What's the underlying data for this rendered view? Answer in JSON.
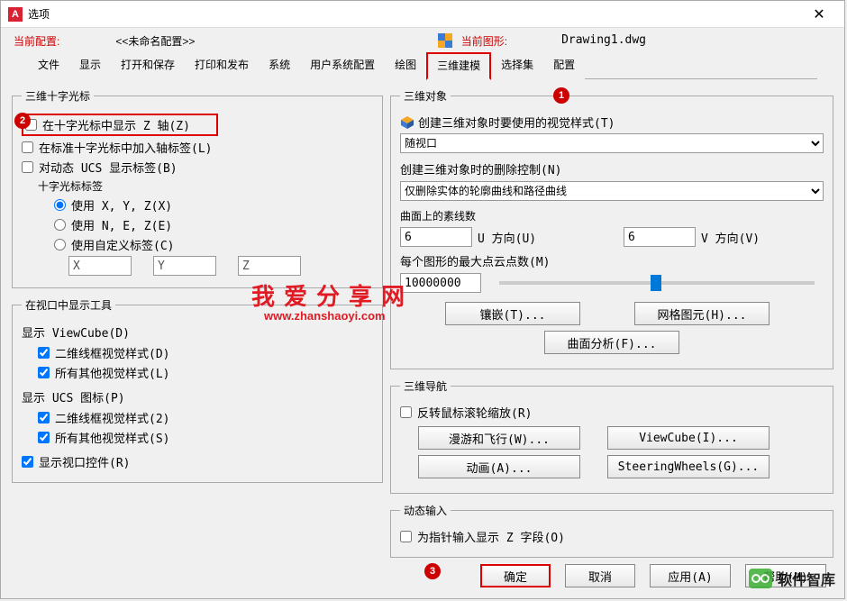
{
  "titlebar": {
    "title": "选项"
  },
  "header": {
    "profile_label": "当前配置:",
    "profile_value": "<<未命名配置>>",
    "drawing_label": "当前图形:",
    "drawing_value": "Drawing1.dwg"
  },
  "tabs": {
    "items": [
      "文件",
      "显示",
      "打开和保存",
      "打印和发布",
      "系统",
      "用户系统配置",
      "绘图",
      "三维建模",
      "选择集",
      "配置"
    ],
    "active": "三维建模"
  },
  "left": {
    "group_crosshair": "三维十字光标",
    "show_z": "在十字光标中显示 Z 轴(Z)",
    "axis_labels_std": "在标准十字光标中加入轴标签(L)",
    "dynamic_ucs": "对动态 UCS 显示标签(B)",
    "crosshair_labels": "十字光标标签",
    "opt_xyz": "使用 X, Y, Z(X)",
    "opt_nez": "使用 N, E, Z(E)",
    "opt_custom": "使用自定义标签(C)",
    "custom_x": "X",
    "custom_y": "Y",
    "custom_z": "Z",
    "group_viewport": "在视口中显示工具",
    "viewcube_label": "显示 ViewCube(D)",
    "vc_2d": "二维线框视觉样式(D)",
    "vc_other": "所有其他视觉样式(L)",
    "ucs_label": "显示 UCS 图标(P)",
    "ucs_2d": "二维线框视觉样式(2)",
    "ucs_other": "所有其他视觉样式(S)",
    "show_vp_controls": "显示视口控件(R)"
  },
  "right": {
    "group_objects": "三维对象",
    "visual_style_label": "创建三维对象时要使用的视觉样式(T)",
    "visual_style_value": "随视口",
    "delete_control_label": "创建三维对象时的删除控制(N)",
    "delete_control_value": "仅删除实体的轮廓曲线和路径曲线",
    "isolines_label": "曲面上的素线数",
    "u_value": "6",
    "u_label": "U 方向(U)",
    "v_value": "6",
    "v_label": "V 方向(V)",
    "maxpoints_label": "每个图形的最大点云点数(M)",
    "maxpoints_value": "10000000",
    "btn_tessellate": "镶嵌(T)...",
    "btn_mesh": "网格图元(H)...",
    "btn_surface": "曲面分析(F)...",
    "group_nav": "三维导航",
    "reverse_wheel": "反转鼠标滚轮缩放(R)",
    "btn_walkfly": "漫游和飞行(W)...",
    "btn_viewcube": "ViewCube(I)...",
    "btn_anim": "动画(A)...",
    "btn_wheels": "SteeringWheels(G)...",
    "group_dyn": "动态输入",
    "dyn_z": "为指针输入显示 Z 字段(O)"
  },
  "footer": {
    "ok": "确定",
    "cancel": "取消",
    "apply": "应用(A)",
    "help": "帮助(H)"
  },
  "watermark": {
    "line1": "我爱分享网",
    "line2": "www.zhanshaoyi.com",
    "corner": "软件智库"
  }
}
